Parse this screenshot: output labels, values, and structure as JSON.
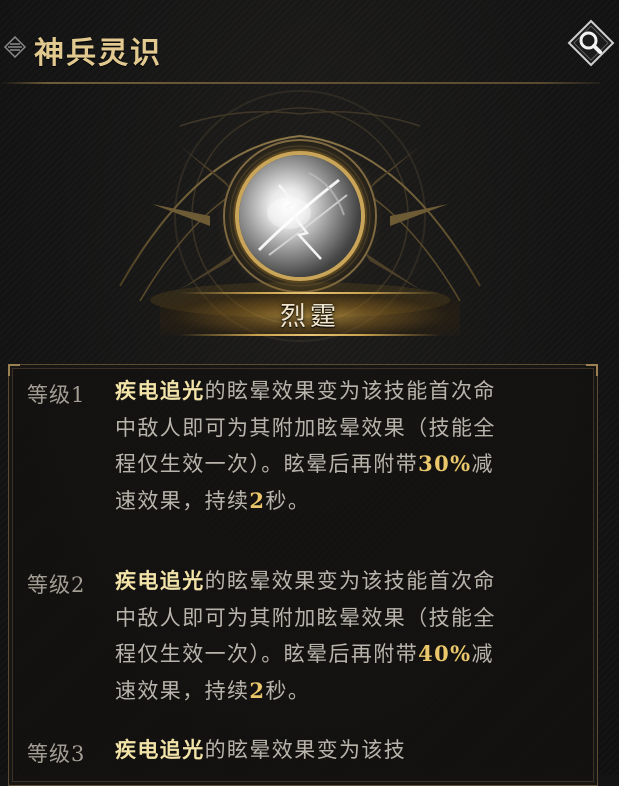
{
  "header": {
    "title": "神兵灵识",
    "search_icon": "magnifier-icon"
  },
  "skill": {
    "name": "烈霆"
  },
  "levels": [
    {
      "label": "等级1",
      "skill_ref": "疾电追光",
      "text_a": "的眩晕效果变为该技能首次命中敌人即可为其附加眩晕效果（技能全程仅生效一次）。眩晕后再附带",
      "percent": "30%",
      "text_b": "减速效果，持续",
      "duration": "2",
      "text_c": "秒。"
    },
    {
      "label": "等级2",
      "skill_ref": "疾电追光",
      "text_a": "的眩晕效果变为该技能首次命中敌人即可为其附加眩晕效果（技能全程仅生效一次）。眩晕后再附带",
      "percent": "40%",
      "text_b": "减速效果，持续",
      "duration": "2",
      "text_c": "秒。"
    },
    {
      "label": "等级3",
      "skill_ref": "疾电追光",
      "text_a": "的眩晕效果变为该技"
    }
  ],
  "colors": {
    "title": "#e2c98f",
    "highlight_name": "#f2e3a8",
    "highlight_number": "#e9c76a",
    "body_text": "#b9b4ab"
  }
}
